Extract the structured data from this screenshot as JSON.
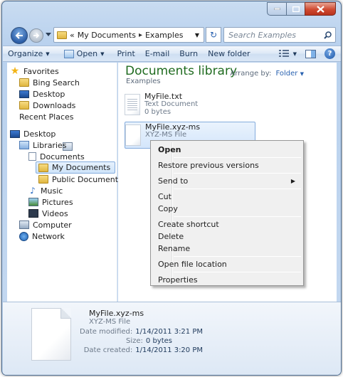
{
  "window": {
    "caption_buttons": [
      "minimize",
      "maximize",
      "close"
    ]
  },
  "address": {
    "overflow": "«",
    "crumbs": [
      "My Documents",
      "Examples"
    ],
    "search_placeholder": "Search Examples"
  },
  "toolbar": {
    "organize": "Organize",
    "open": "Open",
    "print": "Print",
    "email": "E-mail",
    "burn": "Burn",
    "new_folder": "New folder",
    "help": "?"
  },
  "nav": {
    "favorites": "Favorites",
    "bing_search": "Bing Search",
    "desktop_fav": "Desktop",
    "downloads": "Downloads",
    "recent_places": "Recent Places",
    "desktop": "Desktop",
    "libraries": "Libraries",
    "documents": "Documents",
    "my_documents": "My Documents",
    "public_documents": "Public Documents",
    "music": "Music",
    "pictures": "Pictures",
    "videos": "Videos",
    "computer": "Computer",
    "network": "Network"
  },
  "content": {
    "title": "Documents library",
    "subtitle": "Examples",
    "arrange_label": "Arrange by:",
    "arrange_value": "Folder",
    "files": [
      {
        "name": "MyFile.txt",
        "type": "Text Document",
        "size": "0 bytes"
      },
      {
        "name": "MyFile.xyz-ms",
        "type": "XYZ-MS File"
      }
    ]
  },
  "context_menu": {
    "open": "Open",
    "restore": "Restore previous versions",
    "send_to": "Send to",
    "cut": "Cut",
    "copy": "Copy",
    "create_shortcut": "Create shortcut",
    "delete": "Delete",
    "rename": "Rename",
    "open_location": "Open file location",
    "properties": "Properties"
  },
  "details": {
    "name": "MyFile.xyz-ms",
    "type": "XYZ-MS File",
    "modified_label": "Date modified:",
    "modified_value": "1/14/2011 3:21 PM",
    "size_label": "Size:",
    "size_value": "0 bytes",
    "created_label": "Date created:",
    "created_value": "1/14/2011 3:20 PM"
  }
}
